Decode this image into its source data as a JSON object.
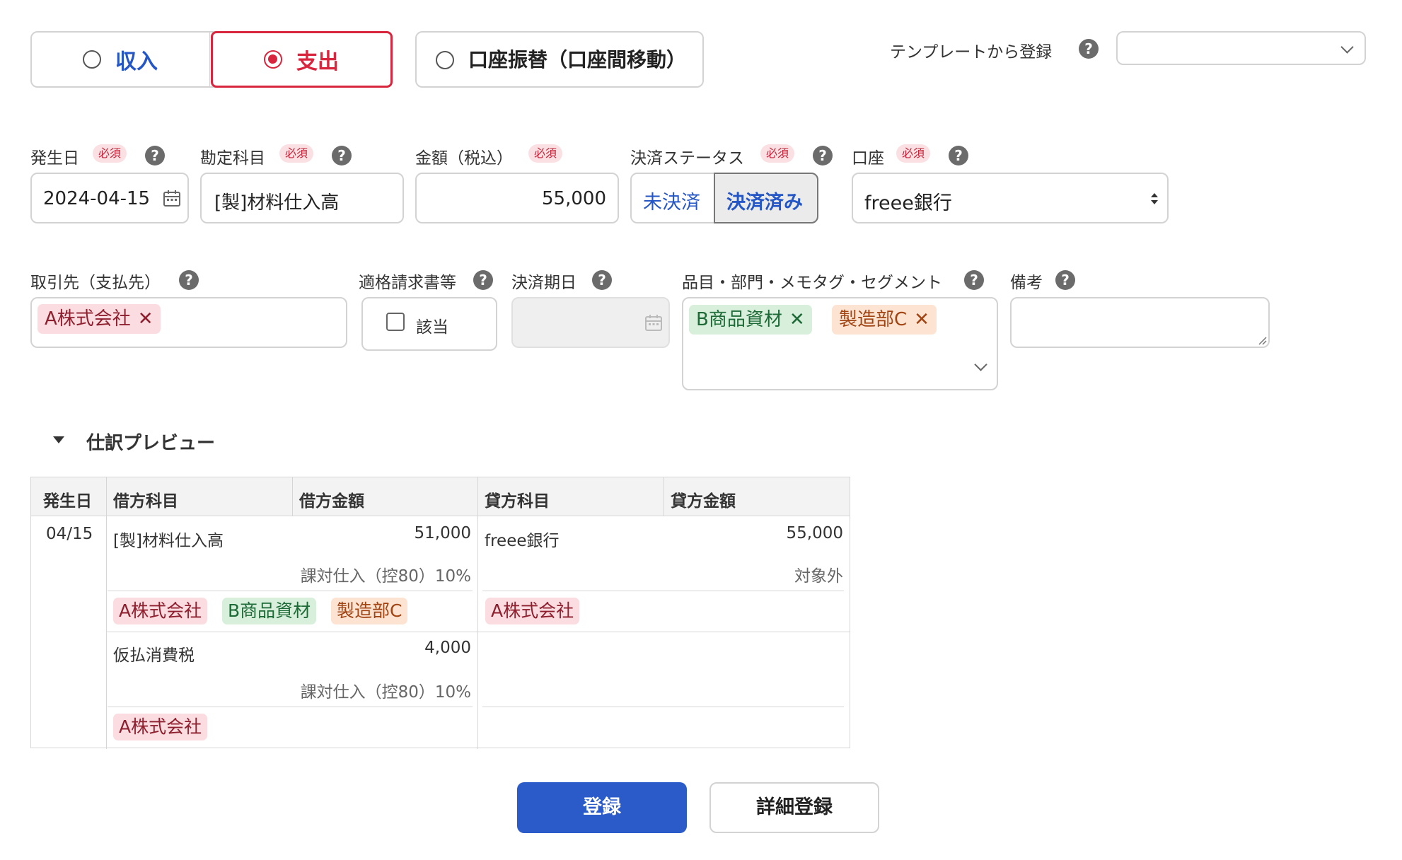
{
  "tx_type": {
    "income": "収入",
    "expense": "支出",
    "transfer": "口座振替（口座間移動）"
  },
  "template": {
    "label": "テンプレートから登録",
    "selected": ""
  },
  "form": {
    "required_badge": "必須",
    "date": {
      "label": "発生日",
      "value": "2024-04-15"
    },
    "account_item": {
      "label": "勘定科目",
      "value": "[製]材料仕入高"
    },
    "amount": {
      "label": "金額（税込）",
      "value": "55,000"
    },
    "status": {
      "label": "決済ステータス",
      "unsettled": "未決済",
      "settled": "決済済み"
    },
    "wallet": {
      "label": "口座",
      "value": "freee銀行"
    },
    "partner": {
      "label": "取引先（支払先）",
      "tag": "A株式会社"
    },
    "invoice": {
      "label": "適格請求書等",
      "checkbox_label": "該当"
    },
    "due_date": {
      "label": "決済期日",
      "value": ""
    },
    "tags": {
      "label": "品目・部門・メモタグ・セグメント",
      "items": [
        "B商品資材",
        "製造部C"
      ]
    },
    "memo": {
      "label": "備考",
      "value": ""
    }
  },
  "preview": {
    "title": "仕訳プレビュー",
    "headers": [
      "発生日",
      "借方科目",
      "借方金額",
      "貸方科目",
      "貸方金額"
    ],
    "date": "04/15",
    "rows": [
      {
        "debit_account": "[製]材料仕入高",
        "debit_amount": "51,000",
        "debit_tax": "課対仕入（控80）10%",
        "debit_tags": [
          "A株式会社",
          "B商品資材",
          "製造部C"
        ],
        "credit_account": "freee銀行",
        "credit_amount": "55,000",
        "credit_tax": "対象外",
        "credit_tags": [
          "A株式会社"
        ]
      },
      {
        "debit_account": "仮払消費税",
        "debit_amount": "4,000",
        "debit_tax": "課対仕入（控80）10%",
        "debit_tags": [
          "A株式会社"
        ]
      }
    ]
  },
  "actions": {
    "register": "登録",
    "detail_register": "詳細登録"
  },
  "colors": {
    "accent_red": "#d7263d",
    "link_blue": "#2456c6",
    "primary_button": "#2a5bc9"
  }
}
